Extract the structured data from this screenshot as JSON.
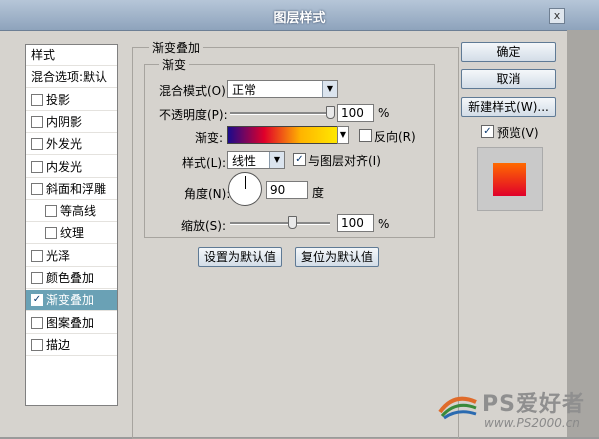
{
  "window": {
    "title": "图层样式",
    "close_glyph": "x"
  },
  "styles_panel": {
    "items": [
      {
        "label": "样式",
        "checkbox": false,
        "checked": false,
        "indent": 0
      },
      {
        "label": "混合选项:默认",
        "checkbox": false,
        "checked": false,
        "indent": 0
      },
      {
        "label": "投影",
        "checkbox": true,
        "checked": false,
        "indent": 0
      },
      {
        "label": "内阴影",
        "checkbox": true,
        "checked": false,
        "indent": 0
      },
      {
        "label": "外发光",
        "checkbox": true,
        "checked": false,
        "indent": 0
      },
      {
        "label": "内发光",
        "checkbox": true,
        "checked": false,
        "indent": 0
      },
      {
        "label": "斜面和浮雕",
        "checkbox": true,
        "checked": false,
        "indent": 0
      },
      {
        "label": "等高线",
        "checkbox": true,
        "checked": false,
        "indent": 1
      },
      {
        "label": "纹理",
        "checkbox": true,
        "checked": false,
        "indent": 1
      },
      {
        "label": "光泽",
        "checkbox": true,
        "checked": false,
        "indent": 0
      },
      {
        "label": "颜色叠加",
        "checkbox": true,
        "checked": false,
        "indent": 0
      },
      {
        "label": "渐变叠加",
        "checkbox": true,
        "checked": true,
        "indent": 0,
        "selected": true
      },
      {
        "label": "图案叠加",
        "checkbox": true,
        "checked": false,
        "indent": 0
      },
      {
        "label": "描边",
        "checkbox": true,
        "checked": false,
        "indent": 0
      }
    ]
  },
  "gradient_overlay": {
    "group_title": "渐变叠加",
    "sub_title": "渐变",
    "blend_mode_label": "混合模式(O):",
    "blend_mode_value": "正常",
    "opacity_label": "不透明度(P):",
    "opacity_value": "100",
    "opacity_unit": "%",
    "opacity_level": 1.0,
    "gradient_label": "渐变:",
    "gradient_colors": [
      "#1a0a8c",
      "#e0002a",
      "#ffb400",
      "#ffe800"
    ],
    "reverse_label": "反向(R)",
    "reverse_checked": false,
    "style_label": "样式(L):",
    "style_value": "线性",
    "align_label": "与图层对齐(I)",
    "align_checked": true,
    "angle_label": "角度(N):",
    "angle_value": "90",
    "angle_unit": "度",
    "scale_label": "缩放(S):",
    "scale_value": "100",
    "scale_unit": "%",
    "scale_level": 0.5,
    "make_default_label": "设置为默认值",
    "reset_default_label": "复位为默认值"
  },
  "right_panel": {
    "ok_label": "确定",
    "cancel_label": "取消",
    "new_style_label": "新建样式(W)...",
    "preview_label": "预览(V)",
    "preview_checked": true,
    "preview_swatch_colors": [
      "#ff6a00",
      "#e0002a"
    ]
  },
  "watermark": {
    "brand": "PS爱好者",
    "url": "www.PS2000.cn"
  }
}
